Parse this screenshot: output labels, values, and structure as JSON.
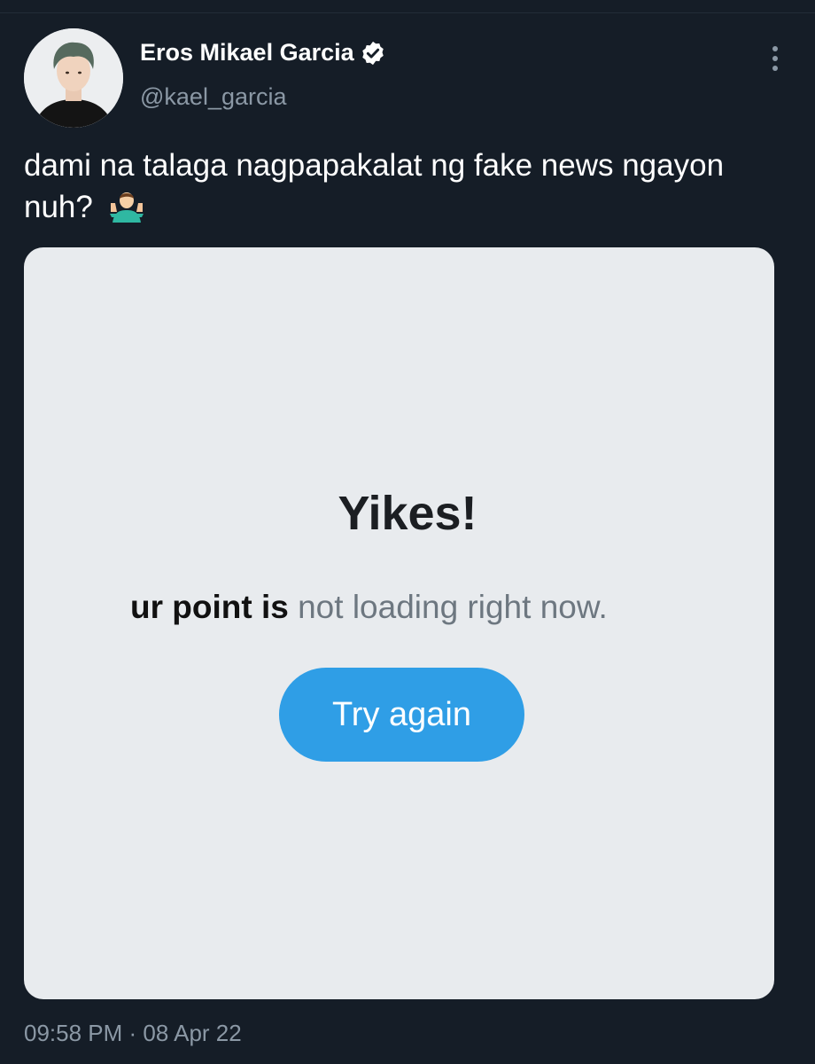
{
  "author": {
    "display_name": "Eros Mikael Garcia",
    "handle": "@kael_garcia",
    "avatar_icon": "profile-photo",
    "verified_icon": "verified-badge-icon"
  },
  "tweet": {
    "text": "dami na talaga nagpapakalat ng fake news ngayon nuh?",
    "emoji_icon": "person-shrugging-emoji"
  },
  "card": {
    "heading": "Yikes!",
    "message_bold": "ur point is",
    "message_light": "not loading right now.",
    "button_label": "Try again"
  },
  "meta": {
    "timestamp": "09:58 PM · 08 Apr 22"
  },
  "colors": {
    "background": "#151d27",
    "card_background": "#e8ebee",
    "button": "#2f9ee6",
    "muted_text": "#8b98a5"
  }
}
